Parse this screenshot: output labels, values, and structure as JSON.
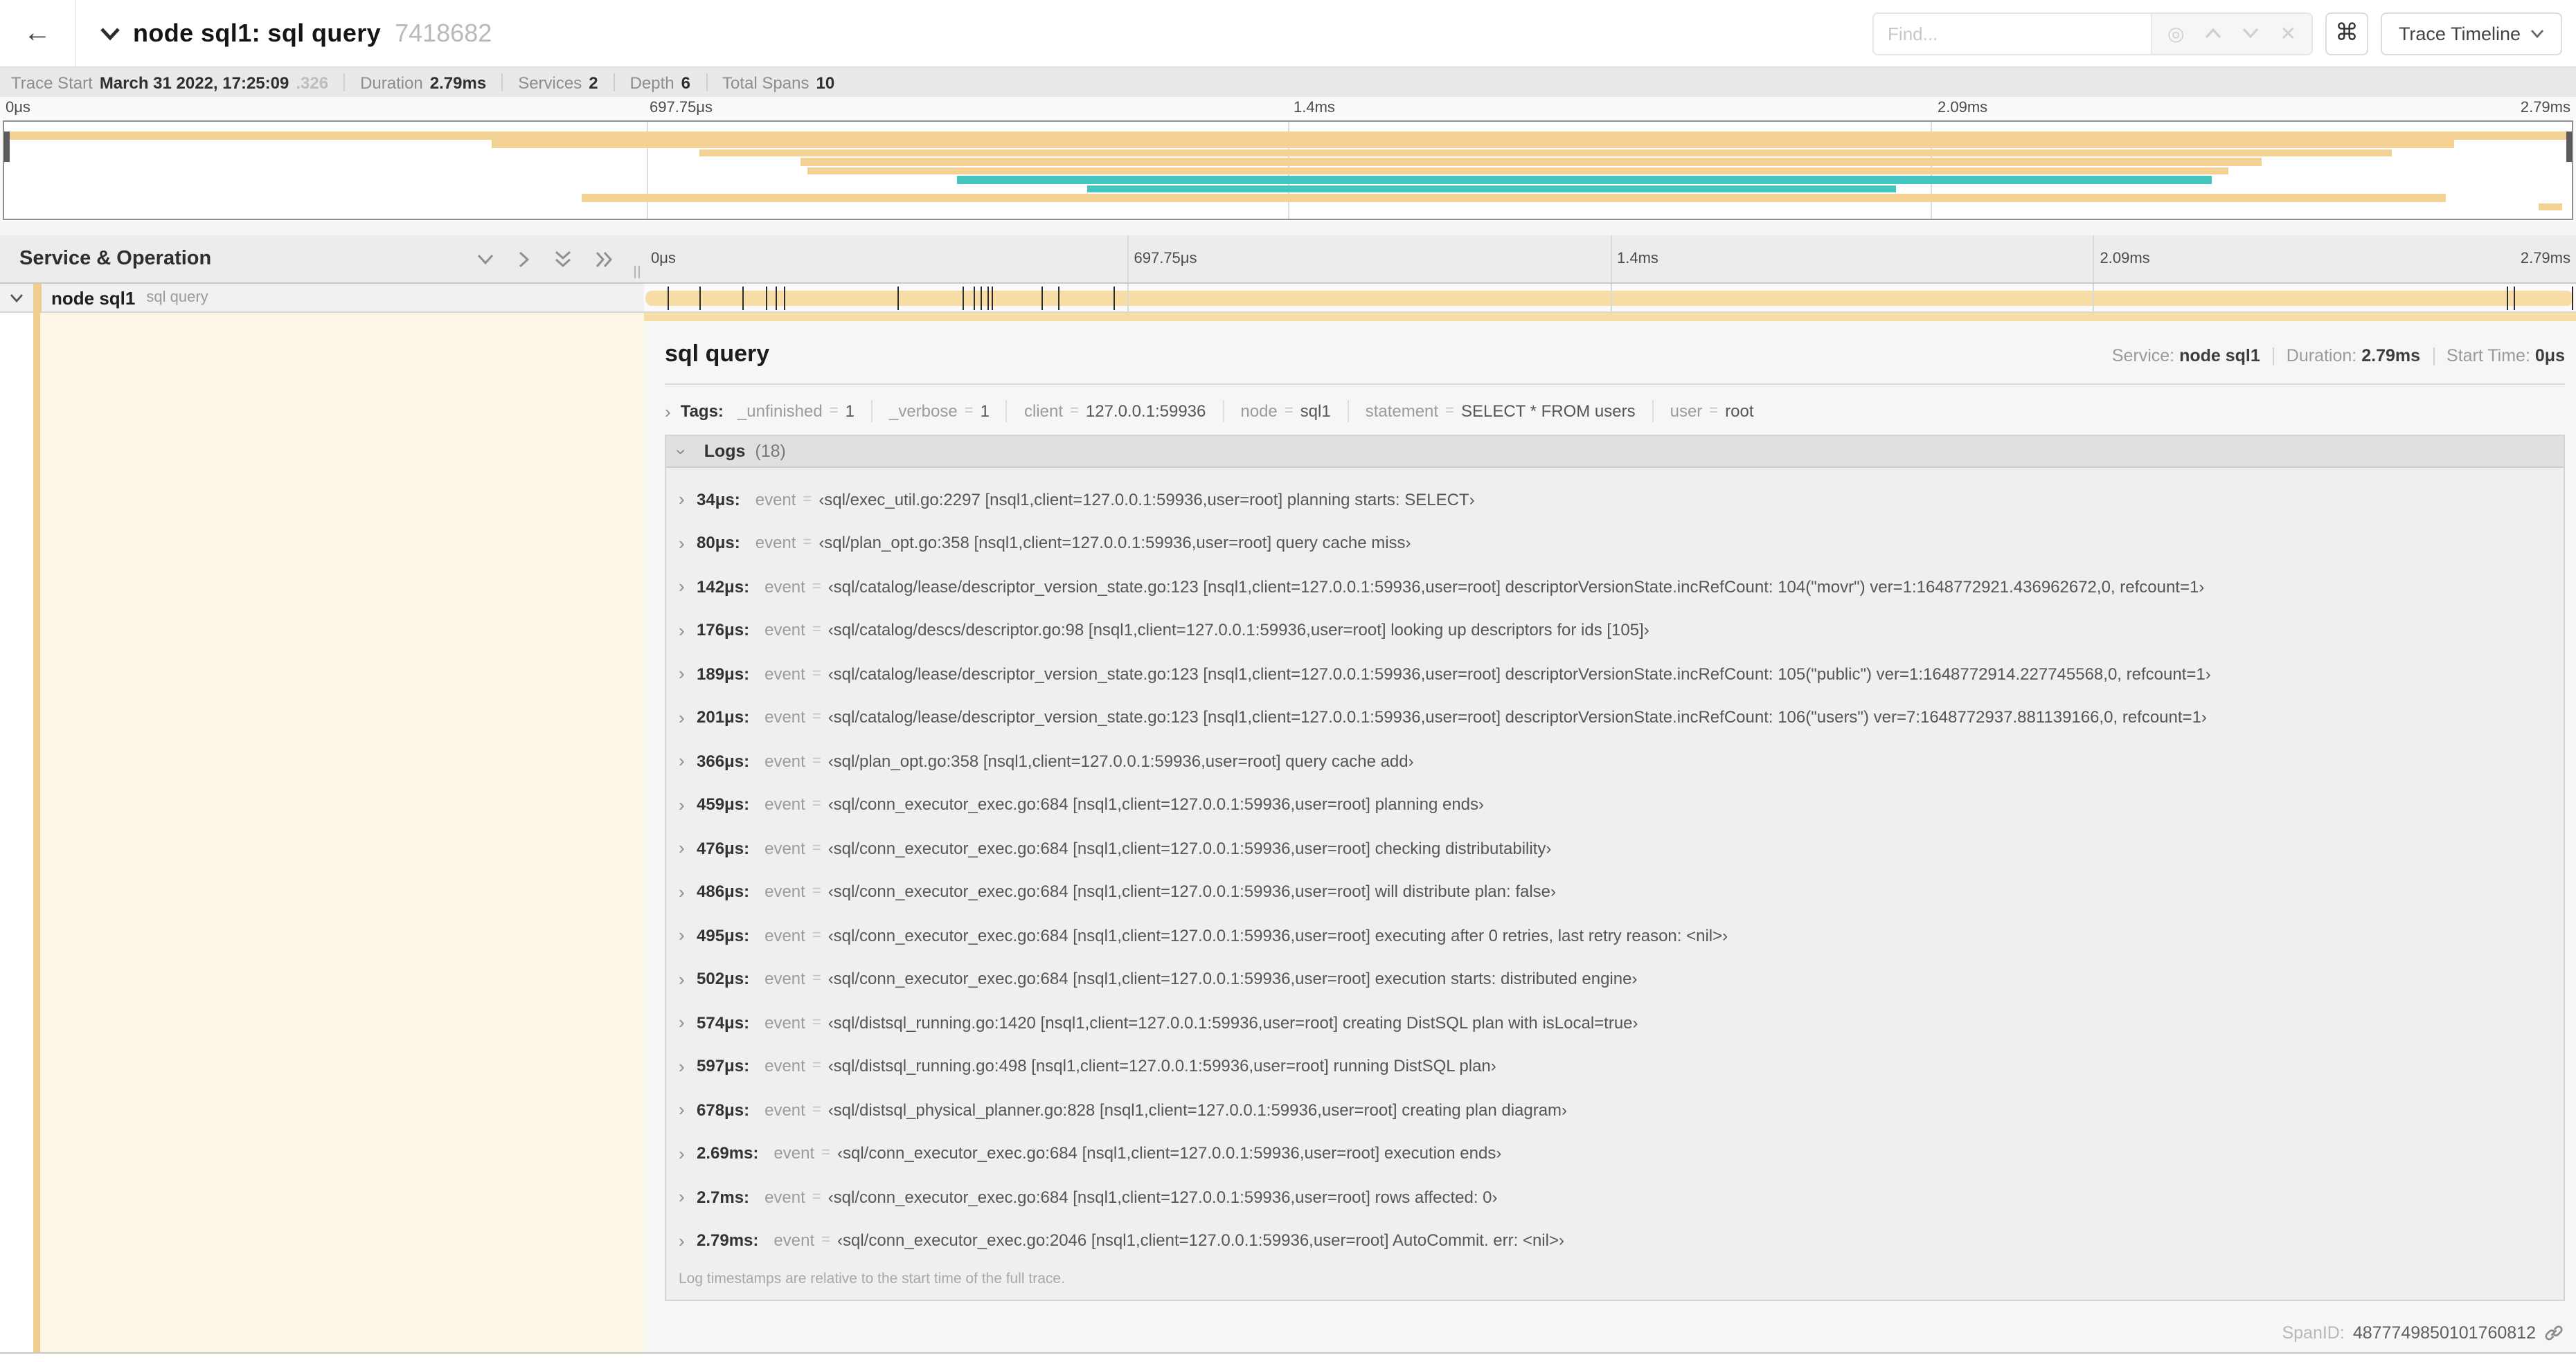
{
  "header": {
    "back": "←",
    "title": "node sql1: sql query",
    "trace_id": "7418682",
    "find_placeholder": "Find...",
    "cmd_symbol": "⌘",
    "view_selector": "Trace Timeline"
  },
  "meta": {
    "items": [
      {
        "label": "Trace Start",
        "value": "March 31 2022, 17:25:09",
        "muted": ".326"
      },
      {
        "label": "Duration",
        "value": "2.79ms"
      },
      {
        "label": "Services",
        "value": "2"
      },
      {
        "label": "Depth",
        "value": "6"
      },
      {
        "label": "Total Spans",
        "value": "10"
      }
    ]
  },
  "colors": {
    "span_tan": "#f7dca5",
    "minimap_tan": "#f3d193",
    "minimap_teal": "#45c5c0",
    "accent_stripe": "#efcf90",
    "cream": "#fdf6e7"
  },
  "timeline": {
    "ticks": [
      "0μs",
      "697.75μs",
      "1.4ms",
      "2.09ms",
      "2.79ms"
    ],
    "tick_positions_pct": [
      0,
      25,
      50,
      75,
      100
    ],
    "left_header": "Service & Operation",
    "total_us": 2790,
    "log_marker_times_us": [
      34,
      80,
      142,
      176,
      189,
      201,
      366,
      459,
      476,
      486,
      495,
      502,
      574,
      597,
      678,
      2690,
      2700,
      2790
    ]
  },
  "minimap": {
    "bars": [
      {
        "row": 0,
        "start_pct": 0,
        "end_pct": 100,
        "color": "minimap_tan"
      },
      {
        "row": 1,
        "start_pct": 19.0,
        "end_pct": 95.4,
        "color": "minimap_tan"
      },
      {
        "row": 2,
        "start_pct": 27.1,
        "end_pct": 93.0,
        "color": "minimap_tan"
      },
      {
        "row": 3,
        "start_pct": 31.0,
        "end_pct": 87.9,
        "color": "minimap_tan"
      },
      {
        "row": 4,
        "start_pct": 31.3,
        "end_pct": 86.6,
        "color": "minimap_tan"
      },
      {
        "row": 5,
        "start_pct": 37.1,
        "end_pct": 86.0,
        "color": "minimap_teal"
      },
      {
        "row": 6,
        "start_pct": 42.2,
        "end_pct": 73.7,
        "color": "minimap_teal"
      },
      {
        "row": 7,
        "start_pct": 22.5,
        "end_pct": 95.1,
        "color": "minimap_tan"
      },
      {
        "row": 8,
        "start_pct": 98.7,
        "end_pct": 99.6,
        "color": "minimap_tan"
      }
    ]
  },
  "span_row": {
    "service": "node sql1",
    "operation": "sql query"
  },
  "detail": {
    "title": "sql query",
    "service_label": "Service:",
    "service": "node sql1",
    "duration_label": "Duration:",
    "duration": "2.79ms",
    "start_label": "Start Time:",
    "start": "0μs",
    "tags_label": "Tags:",
    "tags": [
      {
        "key": "_unfinished",
        "value": "1"
      },
      {
        "key": "_verbose",
        "value": "1"
      },
      {
        "key": "client",
        "value": "127.0.0.1:59936"
      },
      {
        "key": "node",
        "value": "sql1"
      },
      {
        "key": "statement",
        "value": "SELECT * FROM users"
      },
      {
        "key": "user",
        "value": "root"
      }
    ],
    "logs_label": "Logs",
    "logs_count": "(18)",
    "logs": [
      {
        "ts": "34μs:",
        "key": "event",
        "value": "‹sql/exec_util.go:2297 [nsql1,client=127.0.0.1:59936,user=root] planning starts: SELECT›"
      },
      {
        "ts": "80μs:",
        "key": "event",
        "value": "‹sql/plan_opt.go:358 [nsql1,client=127.0.0.1:59936,user=root] query cache miss›"
      },
      {
        "ts": "142μs:",
        "key": "event",
        "value": "‹sql/catalog/lease/descriptor_version_state.go:123 [nsql1,client=127.0.0.1:59936,user=root] descriptorVersionState.incRefCount: 104(\"movr\") ver=1:1648772921.436962672,0, refcount=1›"
      },
      {
        "ts": "176μs:",
        "key": "event",
        "value": "‹sql/catalog/descs/descriptor.go:98 [nsql1,client=127.0.0.1:59936,user=root] looking up descriptors for ids [105]›"
      },
      {
        "ts": "189μs:",
        "key": "event",
        "value": "‹sql/catalog/lease/descriptor_version_state.go:123 [nsql1,client=127.0.0.1:59936,user=root] descriptorVersionState.incRefCount: 105(\"public\") ver=1:1648772914.227745568,0, refcount=1›"
      },
      {
        "ts": "201μs:",
        "key": "event",
        "value": "‹sql/catalog/lease/descriptor_version_state.go:123 [nsql1,client=127.0.0.1:59936,user=root] descriptorVersionState.incRefCount: 106(\"users\") ver=7:1648772937.881139166,0, refcount=1›"
      },
      {
        "ts": "366μs:",
        "key": "event",
        "value": "‹sql/plan_opt.go:358 [nsql1,client=127.0.0.1:59936,user=root] query cache add›"
      },
      {
        "ts": "459μs:",
        "key": "event",
        "value": "‹sql/conn_executor_exec.go:684 [nsql1,client=127.0.0.1:59936,user=root] planning ends›"
      },
      {
        "ts": "476μs:",
        "key": "event",
        "value": "‹sql/conn_executor_exec.go:684 [nsql1,client=127.0.0.1:59936,user=root] checking distributability›"
      },
      {
        "ts": "486μs:",
        "key": "event",
        "value": "‹sql/conn_executor_exec.go:684 [nsql1,client=127.0.0.1:59936,user=root] will distribute plan: false›"
      },
      {
        "ts": "495μs:",
        "key": "event",
        "value": "‹sql/conn_executor_exec.go:684 [nsql1,client=127.0.0.1:59936,user=root] executing after 0 retries, last retry reason: <nil>›"
      },
      {
        "ts": "502μs:",
        "key": "event",
        "value": "‹sql/conn_executor_exec.go:684 [nsql1,client=127.0.0.1:59936,user=root] execution starts: distributed engine›"
      },
      {
        "ts": "574μs:",
        "key": "event",
        "value": "‹sql/distsql_running.go:1420 [nsql1,client=127.0.0.1:59936,user=root] creating DistSQL plan with isLocal=true›"
      },
      {
        "ts": "597μs:",
        "key": "event",
        "value": "‹sql/distsql_running.go:498 [nsql1,client=127.0.0.1:59936,user=root] running DistSQL plan›"
      },
      {
        "ts": "678μs:",
        "key": "event",
        "value": "‹sql/distsql_physical_planner.go:828 [nsql1,client=127.0.0.1:59936,user=root] creating plan diagram›"
      },
      {
        "ts": "2.69ms:",
        "key": "event",
        "value": "‹sql/conn_executor_exec.go:684 [nsql1,client=127.0.0.1:59936,user=root] execution ends›"
      },
      {
        "ts": "2.7ms:",
        "key": "event",
        "value": "‹sql/conn_executor_exec.go:684 [nsql1,client=127.0.0.1:59936,user=root] rows affected: 0›"
      },
      {
        "ts": "2.79ms:",
        "key": "event",
        "value": "‹sql/conn_executor_exec.go:2046 [nsql1,client=127.0.0.1:59936,user=root] AutoCommit. err: <nil>›"
      }
    ],
    "footer": "Log timestamps are relative to the start time of the full trace.",
    "span_id_label": "SpanID:",
    "span_id": "4877749850101760812"
  }
}
